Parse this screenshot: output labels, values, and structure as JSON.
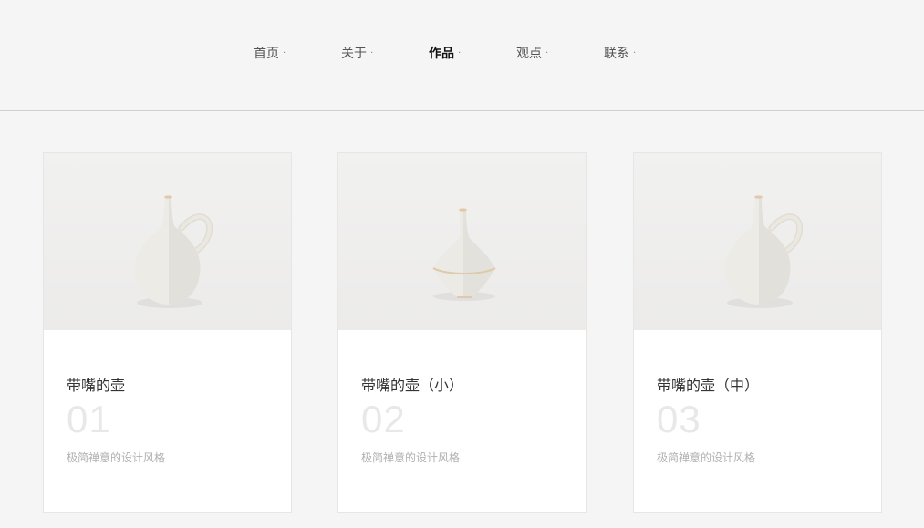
{
  "nav": {
    "items": [
      {
        "label": "首页",
        "dot": "·"
      },
      {
        "label": "关于",
        "dot": "·"
      },
      {
        "label": "作品",
        "dot": "·"
      },
      {
        "label": "观点",
        "dot": "·"
      },
      {
        "label": "联系",
        "dot": "·"
      }
    ],
    "active_index": 2
  },
  "works": [
    {
      "title": "带嘴的壶",
      "number": "01",
      "description": "极简禅意的设计风格",
      "image_icon": "handled-jug-image"
    },
    {
      "title": "带嘴的壶（小）",
      "number": "02",
      "description": "极简禅意的设计风格",
      "image_icon": "spinning-top-vase-image"
    },
    {
      "title": "带嘴的壶（中）",
      "number": "03",
      "description": "极简禅意的设计风格",
      "image_icon": "handled-jug-image"
    }
  ],
  "colors": {
    "background": "#f5f5f5",
    "card": "#ffffff",
    "active_nav": "#111111",
    "number": "#e8e8e8"
  }
}
